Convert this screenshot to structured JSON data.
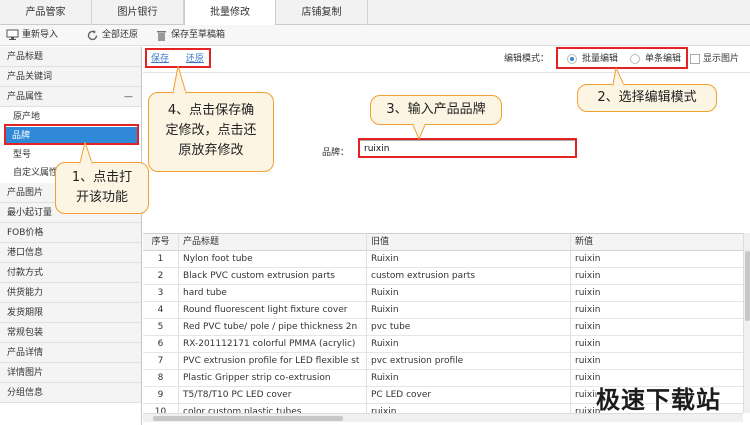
{
  "tabs": [
    {
      "label": "产品管家",
      "active": false
    },
    {
      "label": "图片银行",
      "active": false
    },
    {
      "label": "批量修改",
      "active": true
    },
    {
      "label": "店铺复制",
      "active": false
    }
  ],
  "toolbar": {
    "reimport": "重新导入",
    "restore_all": "全部还原",
    "save_draft": "保存至草稿箱"
  },
  "sidebar": {
    "items": [
      {
        "label": "产品标题"
      },
      {
        "label": "产品关键词"
      },
      {
        "label": "产品属性",
        "expanded_glyph": "—"
      },
      {
        "label": "原产地"
      },
      {
        "label": "品牌"
      },
      {
        "label": "型号"
      },
      {
        "label": "自定义属性"
      },
      {
        "label": "产品图片"
      },
      {
        "label": "最小起订量"
      },
      {
        "label": "FOB价格"
      },
      {
        "label": "港口信息"
      },
      {
        "label": "付款方式"
      },
      {
        "label": "供货能力"
      },
      {
        "label": "发货期限"
      },
      {
        "label": "常规包装"
      },
      {
        "label": "产品详情"
      },
      {
        "label": "详情图片"
      },
      {
        "label": "分组信息"
      }
    ]
  },
  "edit": {
    "save_link": "保存",
    "restore_link": "还原",
    "mode_label": "编辑模式：",
    "mode_batch": "批量编辑",
    "mode_single": "单条编辑",
    "show_images": "显示图片",
    "brand_label": "品牌：",
    "brand_value": "ruixin"
  },
  "table": {
    "columns": [
      "序号",
      "产品标题",
      "旧值",
      "新值"
    ],
    "rows": [
      [
        "1",
        "Nylon foot tube",
        "Ruixin",
        "ruixin"
      ],
      [
        "2",
        "Black PVC custom extrusion parts",
        "custom extrusion parts",
        "ruixin"
      ],
      [
        "3",
        "hard tube",
        "Ruixin",
        "ruixin"
      ],
      [
        "4",
        "Round fluorescent light fixture cover",
        "Ruixin",
        "ruixin"
      ],
      [
        "5",
        "Red PVC tube/ pole / pipe thickness 2n",
        "pvc  tube",
        "ruixin"
      ],
      [
        "6",
        "RX-201112171 colorful PMMA (acrylic)",
        "Ruixin",
        "ruixin"
      ],
      [
        "7",
        "PVC extrusion profile for LED flexible st",
        "pvc extrusion profile",
        "ruixin"
      ],
      [
        "8",
        "Plastic Gripper strip co-extrusion",
        "Ruixin",
        "ruixin"
      ],
      [
        "9",
        "T5/T8/T10 PC LED cover",
        "PC LED cover",
        "ruixin"
      ],
      [
        "10",
        "color custom plastic tubes",
        "ruixin",
        "ruixin"
      ]
    ]
  },
  "callouts": {
    "c1": [
      "1、点击打",
      "开该功能"
    ],
    "c2": "2、选择编辑模式",
    "c3": "3、输入产品品牌",
    "c4": [
      "4、点击保存确",
      "定修改，点击还",
      "原放弃修改"
    ]
  },
  "watermark": "极速下载站",
  "colors": {
    "accent": "#2f89d8",
    "annotation_red": "#e32323",
    "callout_bg": "#fdf5e4",
    "callout_border": "#f0a030"
  }
}
